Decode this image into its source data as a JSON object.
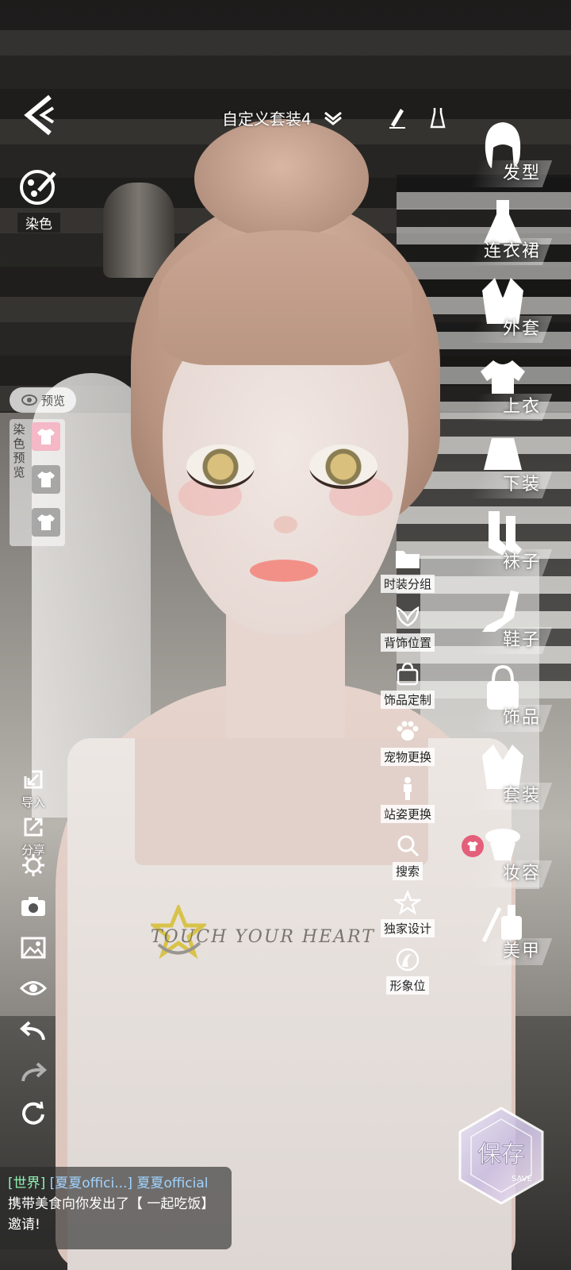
{
  "header": {
    "outfit_name": "自定义套装4"
  },
  "dye": {
    "label": "染色"
  },
  "preview": {
    "tag": "预览",
    "vertical_label": "染色预览"
  },
  "left_tools": {
    "import_label": "导入",
    "share_label": "分享"
  },
  "categories": [
    {
      "label": "发型",
      "icon": "hair-icon"
    },
    {
      "label": "连衣裙",
      "icon": "dress-icon"
    },
    {
      "label": "外套",
      "icon": "coat-icon"
    },
    {
      "label": "上衣",
      "icon": "top-icon"
    },
    {
      "label": "下装",
      "icon": "skirt-icon"
    },
    {
      "label": "袜子",
      "icon": "socks-icon"
    },
    {
      "label": "鞋子",
      "icon": "shoe-icon"
    },
    {
      "label": "饰品",
      "icon": "bag-icon"
    },
    {
      "label": "套装",
      "icon": "suit-icon"
    },
    {
      "label": "妆容",
      "icon": "makeup-icon"
    },
    {
      "label": "美甲",
      "icon": "nail-polish-icon"
    }
  ],
  "mid_tools": [
    {
      "label": "时装分组",
      "icon": "folder-icon"
    },
    {
      "label": "背饰位置",
      "icon": "wing-icon"
    },
    {
      "label": "饰品定制",
      "icon": "bag-icon"
    },
    {
      "label": "宠物更换",
      "icon": "paw-icon"
    },
    {
      "label": "站姿更换",
      "icon": "person-icon"
    },
    {
      "label": "搜索",
      "icon": "search-icon"
    },
    {
      "label": "独家设计",
      "icon": "star-icon"
    },
    {
      "label": "形象位",
      "icon": "portrait-icon"
    }
  ],
  "shirt_print": "TOUCH YOUR HEART",
  "chat": {
    "channel": "[世界]",
    "name_tag": "[夏夏offici...]",
    "sender": "夏夏official",
    "message": "携带美食向你发出了【 一起吃饭】邀请!"
  },
  "save": {
    "label": "保存",
    "sub": "SAVE"
  },
  "colors": {
    "accent_pink": "#f4b8c6",
    "chat_channel": "#8ff0b1",
    "chat_name": "#9fd3ff"
  }
}
